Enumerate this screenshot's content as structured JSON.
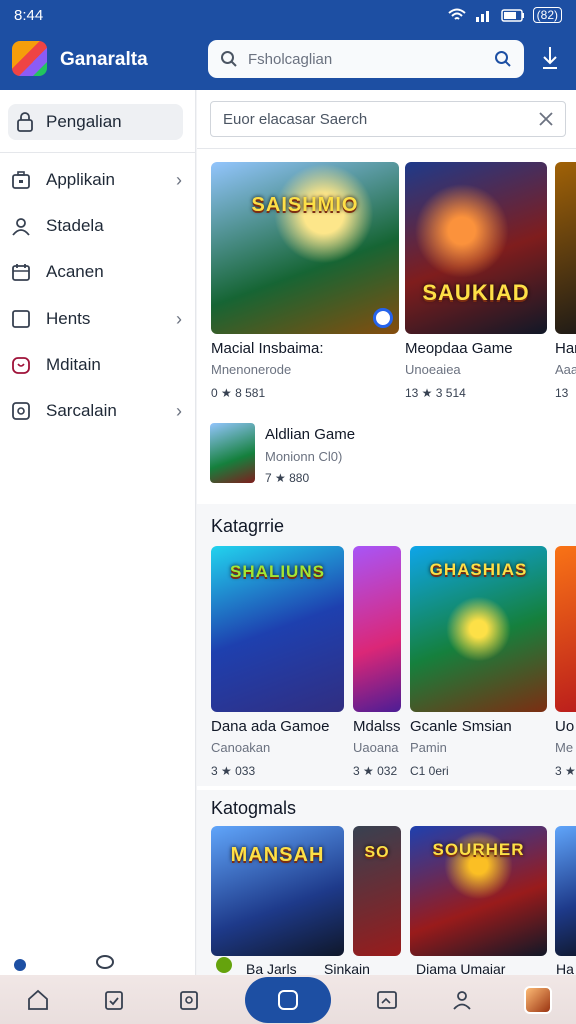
{
  "status_bar": {
    "time": "8:44",
    "battery": "(82)"
  },
  "header": {
    "app_title": "Ganaralta",
    "search_placeholder": "Fsholcaglian",
    "logo_icon": "app-logo-icon",
    "download_icon": "download-icon"
  },
  "sidebar": {
    "home_label": "Pengalian",
    "items": [
      {
        "label": "Applikain",
        "icon": "briefcase-icon",
        "has_chevron": true
      },
      {
        "label": "Stadela",
        "icon": "person-icon",
        "has_chevron": false
      },
      {
        "label": "Acanen",
        "icon": "calendar-icon",
        "has_chevron": false
      },
      {
        "label": "Hents",
        "icon": "square-icon",
        "has_chevron": true
      },
      {
        "label": "Mditain",
        "icon": "bag-icon",
        "has_chevron": false
      },
      {
        "label": "Sarcalain",
        "icon": "settings-icon",
        "has_chevron": true
      }
    ]
  },
  "main": {
    "search_placeholder": "Euor elacasar Saerch",
    "featured": [
      {
        "name": "Macial Insbaima:",
        "sub": "Mnenonerode",
        "rating": "0 ★ 8 581",
        "art": "SAISHMIO"
      },
      {
        "name": "Meopdaa Game",
        "sub": "Unoeaiea",
        "rating": "13 ★ 3 514",
        "art": "SAUKIAD"
      },
      {
        "name": "Har",
        "sub": "Aaa",
        "rating": "13",
        "art": ""
      }
    ],
    "list_item": {
      "name": "Aldlian Game",
      "sub": "Monionn Cl0)",
      "rating": "7 ★ 880"
    },
    "section1": {
      "title": "Katagrrie",
      "cards": [
        {
          "name": "Dana ada Gamoe",
          "sub": "Canoakan",
          "rating": "3 ★ 033",
          "art": "SHALIUNS"
        },
        {
          "name": "Mdalss",
          "sub": "Uaoana",
          "rating": "3 ★ 032",
          "art": ""
        },
        {
          "name": "Gcanle Smsian",
          "sub": "Pamin",
          "rating": "C1 0eri",
          "art": "GHASHIAS"
        },
        {
          "name": "Uo",
          "sub": "Me",
          "rating": "3 ★",
          "art": ""
        }
      ]
    },
    "section2": {
      "title": "Katogmals",
      "cards": [
        {
          "art": "MANSAH"
        },
        {
          "art": "SO"
        },
        {
          "art": "SOURHER"
        },
        {
          "art": ""
        }
      ],
      "peek_labels": [
        "Ba Jarls",
        "Sinkain",
        "Diama Umaiar",
        "Ha"
      ]
    }
  },
  "bottom_nav": [
    {
      "icon": "home-icon"
    },
    {
      "icon": "clipboard-icon"
    },
    {
      "icon": "gamepad-icon"
    },
    {
      "icon": "center-square-icon"
    },
    {
      "icon": "image-icon"
    },
    {
      "icon": "profile-icon"
    },
    {
      "icon": "avatar-icon"
    }
  ],
  "colors": {
    "primary": "#1d4fa3",
    "star": "#f59e0b"
  }
}
